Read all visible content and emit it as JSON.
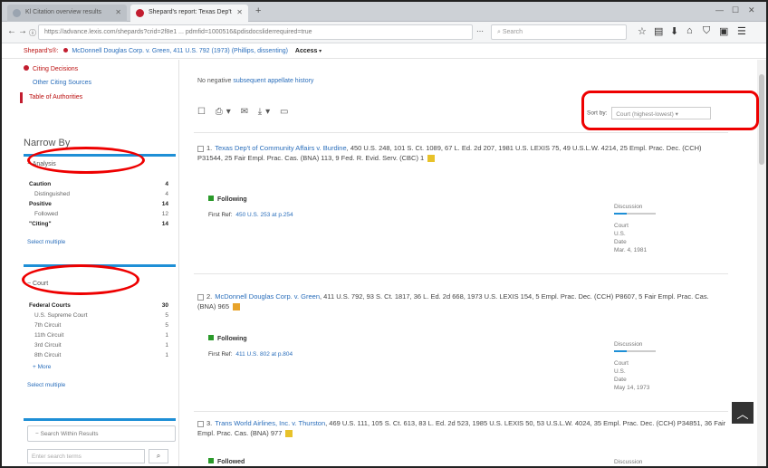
{
  "browser": {
    "tabs": [
      {
        "title": "Kl Citation overview results",
        "active": false
      },
      {
        "title": "Shepard's report: Texas Dep't",
        "active": true
      }
    ],
    "url": "https://advance.lexis.com/shepards?crid=2f8e1 ... pdmfid=1000516&pdisdocsliderrequired=true",
    "url_host": "lexis.com",
    "search_placeholder": "Search",
    "colors": {
      "accent": "#1e8fd6",
      "warning": "#c21d2f",
      "positive": "#2a9a2a"
    }
  },
  "breadcrumb": {
    "prefix": "Shepard's®:",
    "citation": "McDonnell Douglas Corp. v. Green, 411 U.S. 792 (1973) (Phillips, dissenting)",
    "access": "Access"
  },
  "sidebar": {
    "links": [
      {
        "label": "Citing Decisions",
        "current": true
      },
      {
        "label": "Other Citing Sources",
        "current": false
      },
      {
        "label": "Table of Authorities",
        "current": false
      }
    ],
    "narrow_title": "Narrow By",
    "analysis": {
      "header": "Analysis",
      "rows": [
        {
          "label": "Caution",
          "count": "4",
          "bold": true
        },
        {
          "label": "Distinguished",
          "count": "4",
          "bold": false
        },
        {
          "label": "Positive",
          "count": "14",
          "bold": true
        },
        {
          "label": "Followed",
          "count": "12",
          "bold": false
        },
        {
          "label": "\"Citing\"",
          "count": "14",
          "bold": true
        }
      ],
      "select_multiple": "Select multiple"
    },
    "court": {
      "header": "Court",
      "rows": [
        {
          "label": "Federal Courts",
          "count": "30",
          "bold": true
        },
        {
          "label": "U.S. Supreme Court",
          "count": "5",
          "bold": false
        },
        {
          "label": "7th Circuit",
          "count": "5",
          "bold": false
        },
        {
          "label": "11th Circuit",
          "count": "1",
          "bold": false
        },
        {
          "label": "3rd Circuit",
          "count": "1",
          "bold": false
        },
        {
          "label": "8th Circuit",
          "count": "1",
          "bold": false
        }
      ],
      "more": "+ More",
      "select_multiple": "Select multiple"
    },
    "search_within": {
      "header": "Search Within Results",
      "placeholder": "Enter search terms",
      "button_icon": "search-icon"
    }
  },
  "main": {
    "notice_text": "No negative",
    "notice_link": "subsequent appellate history",
    "sort_label": "Sort by:",
    "sort_value": "Court (highest-lowest)",
    "results": [
      {
        "num": "1.",
        "case": "Texas Dep't of Community Affairs v. Burdine",
        "cite": ", 450 U.S. 248, 101 S. Ct. 1089, 67 L. Ed. 2d 207, 1981 U.S. LEXIS 75, 49 U.S.L.W. 4214, 25 Empl. Prac. Dec. (CCH) P31544, 25 Fair Empl. Prac. Cas. (BNA) 113, 9 Fed. R. Evid. Serv. (CBC) 1",
        "status": "Following",
        "first_ref_label": "First Ref:",
        "first_ref": "450 U.S. 253 at p.254",
        "discussion": "Discussion",
        "court_label": "Court",
        "court": "U.S.",
        "date_label": "Date",
        "date": "Mar. 4, 1981"
      },
      {
        "num": "2.",
        "case": "McDonnell Douglas Corp. v. Green",
        "cite": ", 411 U.S. 792, 93 S. Ct. 1817, 36 L. Ed. 2d 668, 1973 U.S. LEXIS 154, 5 Empl. Prac. Dec. (CCH) P8607, 5 Fair Empl. Prac. Cas. (BNA) 965",
        "status": "Following",
        "first_ref_label": "First Ref:",
        "first_ref": "411 U.S. 802 at p.804",
        "discussion": "Discussion",
        "court_label": "Court",
        "court": "U.S.",
        "date_label": "Date",
        "date": "May 14, 1973"
      },
      {
        "num": "3.",
        "case": "Trans World Airlines, Inc. v. Thurston",
        "cite": ", 469 U.S. 111, 105 S. Ct. 613, 83 L. Ed. 2d 523, 1985 U.S. LEXIS 50, 53 U.S.L.W. 4024, 35 Empl. Prac. Dec. (CCH) P34851, 36 Fair Empl. Prac. Cas. (BNA) 977",
        "status": "Followed",
        "discussion": "Discussion"
      }
    ]
  }
}
